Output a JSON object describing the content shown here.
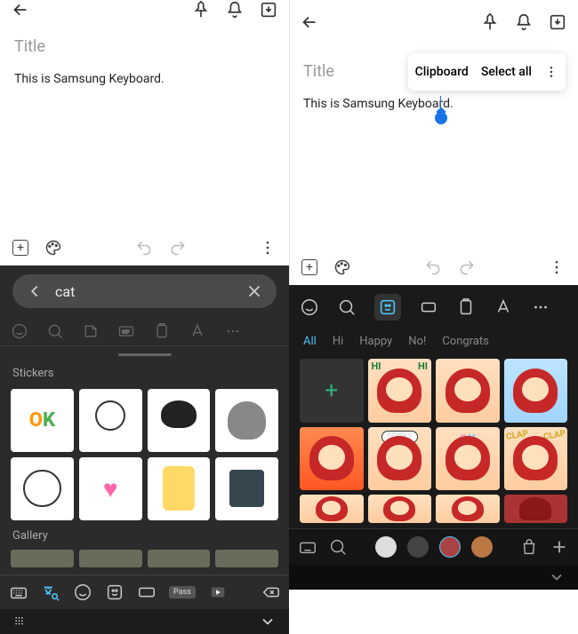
{
  "left": {
    "title_placeholder": "Title",
    "body_text": "This is Samsung Keyboard.",
    "search": {
      "query": "cat"
    },
    "sections": {
      "stickers": "Stickers",
      "gallery": "Gallery"
    },
    "bottom": {
      "pass": "Pass"
    }
  },
  "right": {
    "title_placeholder": "Title",
    "body_text": "This is Samsung Keyboard.",
    "context_menu": {
      "clipboard": "Clipboard",
      "select_all": "Select all"
    },
    "categories": {
      "all": "All",
      "hi": "Hi",
      "happy": "Happy",
      "no": "No!",
      "congrats": "Congrats"
    },
    "labels": {
      "hi": "HI",
      "sorry": "SORRY",
      "ok": "OK",
      "clap": "CLAP"
    }
  }
}
